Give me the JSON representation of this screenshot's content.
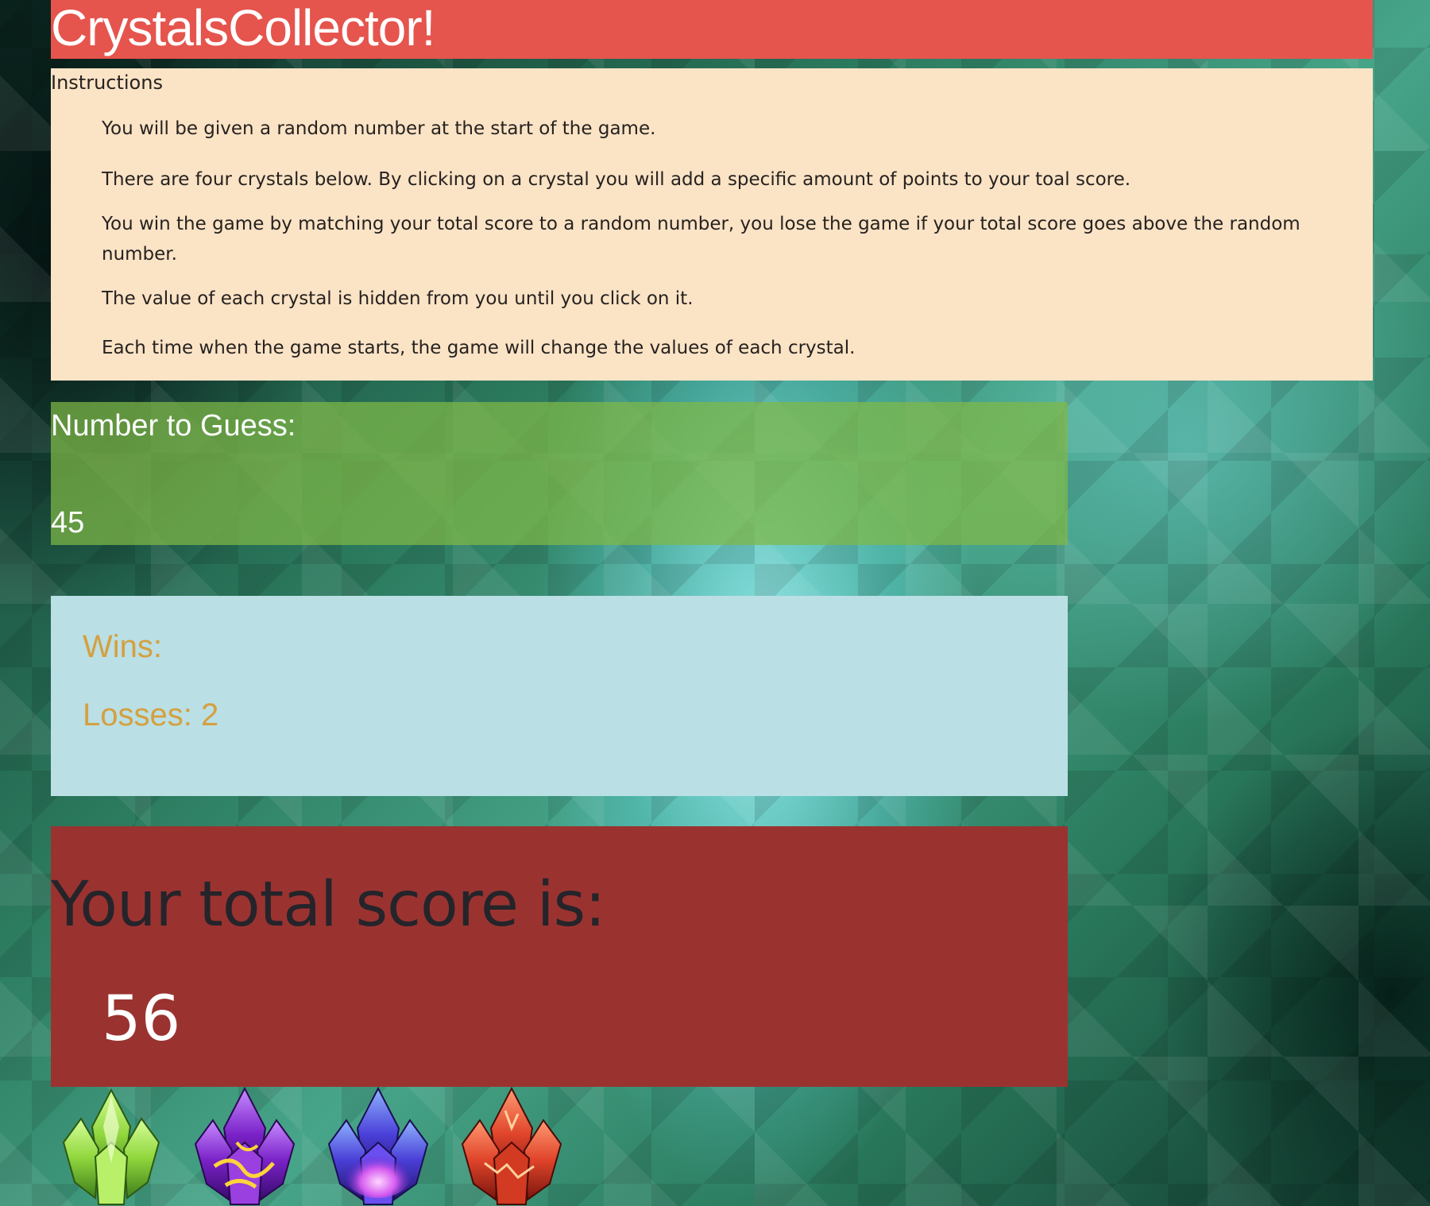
{
  "header": {
    "title": "CrystalsCollector!"
  },
  "instructions": {
    "title": "Instructions",
    "items": [
      "You will be given a random number at the start of the game.",
      "There are four crystals below. By clicking on a crystal you will add a specific amount of points to your toal score.",
      "You win the game by matching your total score to a random number, you lose the game if your total score goes above the random number.",
      "The value of each crystal is hidden from you until you click on it.",
      "Each time when the game starts, the game will change the values of each crystal."
    ]
  },
  "guess": {
    "label": "Number to Guess:",
    "value": "45"
  },
  "stats": {
    "wins_label": "Wins:",
    "wins_value": "",
    "losses_label": "Losses:",
    "losses_value": "2"
  },
  "score": {
    "label": "Your total score is:",
    "value": "56"
  },
  "crystals": [
    {
      "icon": "green-crystal-icon",
      "color": "#9be04a"
    },
    {
      "icon": "purple-gold-crystal-icon",
      "color": "#8a2fd0"
    },
    {
      "icon": "blue-violet-crystal-icon",
      "color": "#6a5cf0"
    },
    {
      "icon": "red-crystal-icon",
      "color": "#e0442a"
    }
  ]
}
